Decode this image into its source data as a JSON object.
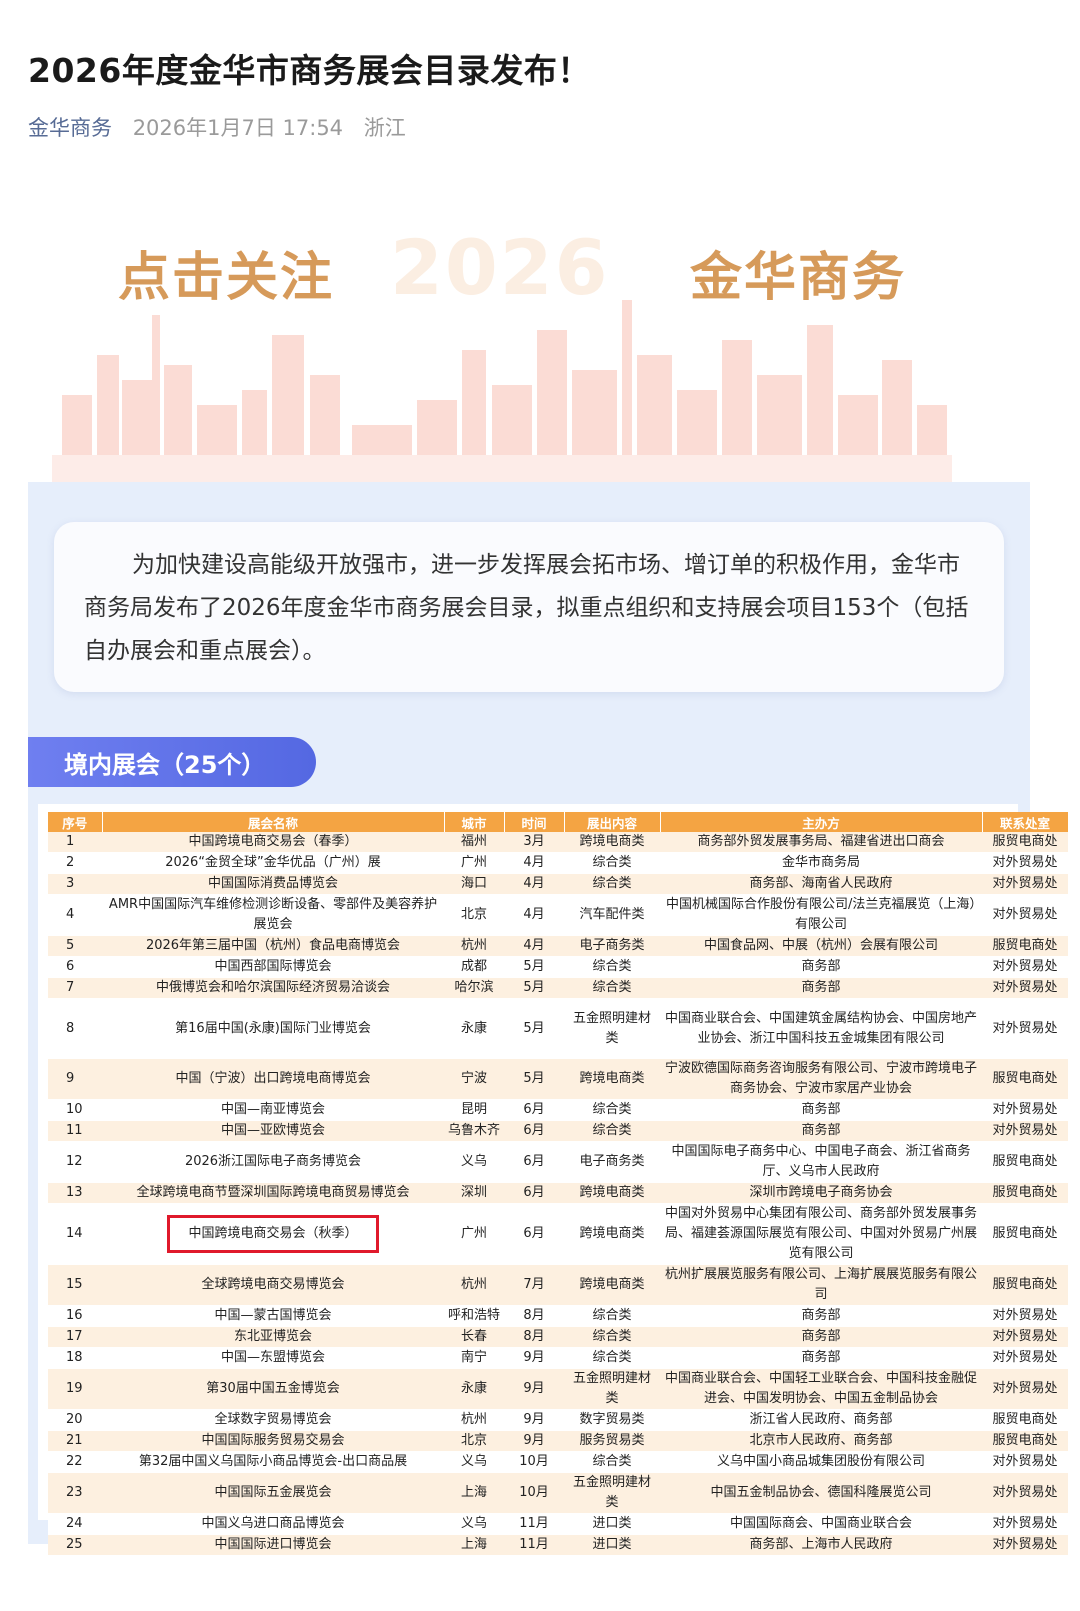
{
  "article": {
    "title": "2026年度金华市商务展会目录发布！",
    "author": "金华商务",
    "datetime": "2026年1月7日 17:54",
    "location": "浙江"
  },
  "banner": {
    "left_text": "点击关注",
    "year_text": "2026",
    "right_text": "金华商务"
  },
  "intro_text": "为加快建设高能级开放强市，进一步发挥展会拓市场、增订单的积极作用，金华市商务局发布了2026年度金华市商务展会目录，拟重点组织和支持展会项目153个（包括自办展会和重点展会）。",
  "section_title": "境内展会（25个）",
  "table": {
    "headers": [
      "序号",
      "展会名称",
      "城市",
      "时间",
      "展出内容",
      "主办方",
      "联系处室"
    ],
    "rows": [
      [
        "1",
        "中国跨境电商交易会（春季）",
        "福州",
        "3月",
        "跨境电商类",
        "商务部外贸发展事务局、福建省进出口商会",
        "服贸电商处"
      ],
      [
        "2",
        "2026“金贸全球”金华优品（广州）展",
        "广州",
        "4月",
        "综合类",
        "金华市商务局",
        "对外贸易处"
      ],
      [
        "3",
        "中国国际消费品博览会",
        "海口",
        "4月",
        "综合类",
        "商务部、海南省人民政府",
        "对外贸易处"
      ],
      [
        "4",
        "AMR中国国际汽车维修检测诊断设备、零部件及美容养护展览会",
        "北京",
        "4月",
        "汽车配件类",
        "中国机械国际合作股份有限公司/法兰克福展览（上海）有限公司",
        "对外贸易处"
      ],
      [
        "5",
        "2026年第三届中国（杭州）食品电商博览会",
        "杭州",
        "4月",
        "电子商务类",
        "中国食品网、中展（杭州）会展有限公司",
        "服贸电商处"
      ],
      [
        "6",
        "中国西部国际博览会",
        "成都",
        "5月",
        "综合类",
        "商务部",
        "对外贸易处"
      ],
      [
        "7",
        "中俄博览会和哈尔滨国际经济贸易洽谈会",
        "哈尔滨",
        "5月",
        "综合类",
        "商务部",
        "对外贸易处"
      ],
      [
        "8",
        "第16届中国(永康)国际门业博览会",
        "永康",
        "5月",
        "五金照明建材类",
        "中国商业联合会、中国建筑金属结构协会、中国房地产业协会、浙江中国科技五金城集团有限公司",
        "对外贸易处"
      ],
      [
        "9",
        "中国（宁波）出口跨境电商博览会",
        "宁波",
        "5月",
        "跨境电商类",
        "宁波欧德国际商务咨询服务有限公司、宁波市跨境电子商务协会、宁波市家居产业协会",
        "服贸电商处"
      ],
      [
        "10",
        "中国—南亚博览会",
        "昆明",
        "6月",
        "综合类",
        "商务部",
        "对外贸易处"
      ],
      [
        "11",
        "中国—亚欧博览会",
        "乌鲁木齐",
        "6月",
        "综合类",
        "商务部",
        "对外贸易处"
      ],
      [
        "12",
        "2026浙江国际电子商务博览会",
        "义乌",
        "6月",
        "电子商务类",
        "中国国际电子商务中心、中国电子商会、浙江省商务厅、义乌市人民政府",
        "服贸电商处"
      ],
      [
        "13",
        "全球跨境电商节暨深圳国际跨境电商贸易博览会",
        "深圳",
        "6月",
        "跨境电商类",
        "深圳市跨境电子商务协会",
        "服贸电商处"
      ],
      [
        "14",
        "中国跨境电商交易会（秋季）",
        "广州",
        "6月",
        "跨境电商类",
        "中国对外贸易中心集团有限公司、商务部外贸发展事务局、福建荟源国际展览有限公司、中国对外贸易广州展览有限公司",
        "服贸电商处"
      ],
      [
        "15",
        "全球跨境电商交易博览会",
        "杭州",
        "7月",
        "跨境电商类",
        "杭州扩展展览服务有限公司、上海扩展展览服务有限公司",
        "服贸电商处"
      ],
      [
        "16",
        "中国—蒙古国博览会",
        "呼和浩特",
        "8月",
        "综合类",
        "商务部",
        "对外贸易处"
      ],
      [
        "17",
        "东北亚博览会",
        "长春",
        "8月",
        "综合类",
        "商务部",
        "对外贸易处"
      ],
      [
        "18",
        "中国—东盟博览会",
        "南宁",
        "9月",
        "综合类",
        "商务部",
        "对外贸易处"
      ],
      [
        "19",
        "第30届中国五金博览会",
        "永康",
        "9月",
        "五金照明建材类",
        "中国商业联合会、中国轻工业联合会、中国科技金融促进会、中国发明协会、中国五金制品协会",
        "对外贸易处"
      ],
      [
        "20",
        "全球数字贸易博览会",
        "杭州",
        "9月",
        "数字贸易类",
        "浙江省人民政府、商务部",
        "服贸电商处"
      ],
      [
        "21",
        "中国国际服务贸易交易会",
        "北京",
        "9月",
        "服务贸易类",
        "北京市人民政府、商务部",
        "服贸电商处"
      ],
      [
        "22",
        "第32届中国义乌国际小商品博览会-出口商品展",
        "义乌",
        "10月",
        "综合类",
        "义乌中国小商品城集团股份有限公司",
        "对外贸易处"
      ],
      [
        "23",
        "中国国际五金展览会",
        "上海",
        "10月",
        "五金照明建材类",
        "中国五金制品协会、德国科隆展览公司",
        "对外贸易处"
      ],
      [
        "24",
        "中国义乌进口商品博览会",
        "义乌",
        "11月",
        "进口类",
        "中国国际商会、中国商业联合会",
        "对外贸易处"
      ],
      [
        "25",
        "中国国际进口博览会",
        "上海",
        "11月",
        "进口类",
        "商务部、上海市人民政府",
        "对外贸易处"
      ]
    ],
    "highlighted_row": "14"
  },
  "colors": {
    "title": "#1a1a1a",
    "author_link": "#576b95",
    "banner_text": "#d69a5a",
    "panel_bg": "#e6eefb",
    "section_tab": "#5c6fe6",
    "table_header": "#f4a443",
    "table_stripe": "#fdf0e0",
    "highlight_box": "#e0192b"
  }
}
